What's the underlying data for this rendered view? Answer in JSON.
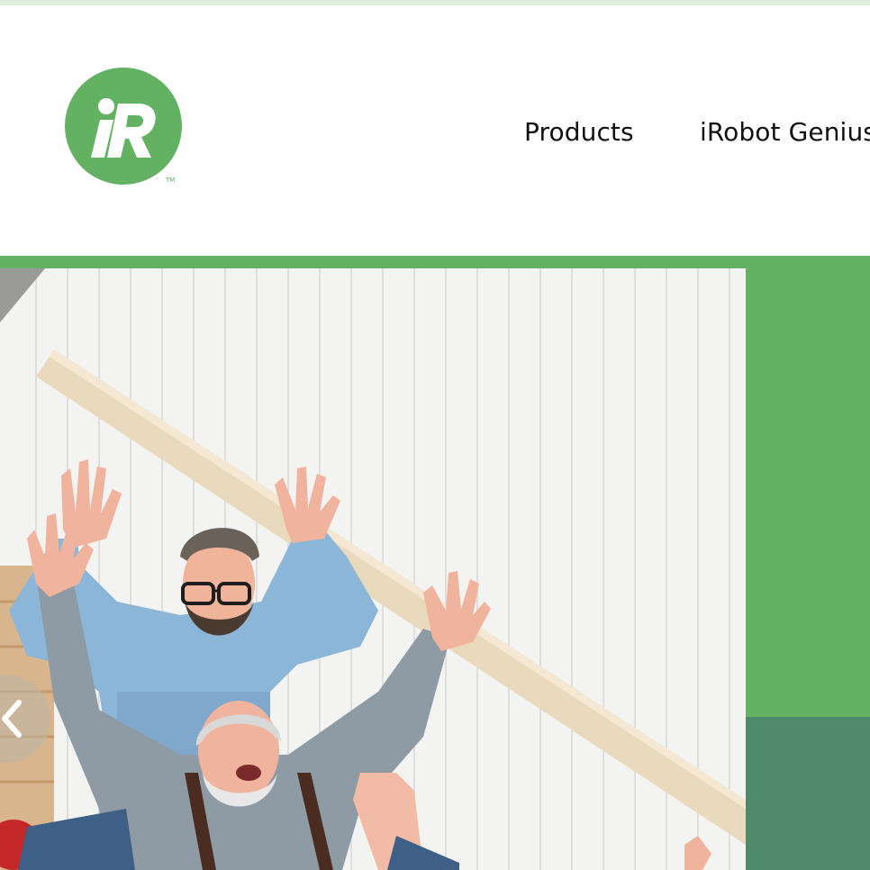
{
  "header": {
    "logo_name": "iRobot",
    "logo_tm": "TM"
  },
  "nav": {
    "items": [
      {
        "label": "Products"
      },
      {
        "label": "iRobot Genius"
      }
    ]
  },
  "hero": {
    "image_name": "family-celebrating-on-stairs",
    "carousel_prev_icon": "chevron-left-icon"
  },
  "colors": {
    "brand_green": "#63b162",
    "dark_teal_green": "#4e8a6a",
    "top_strip": "#dcefdb"
  }
}
